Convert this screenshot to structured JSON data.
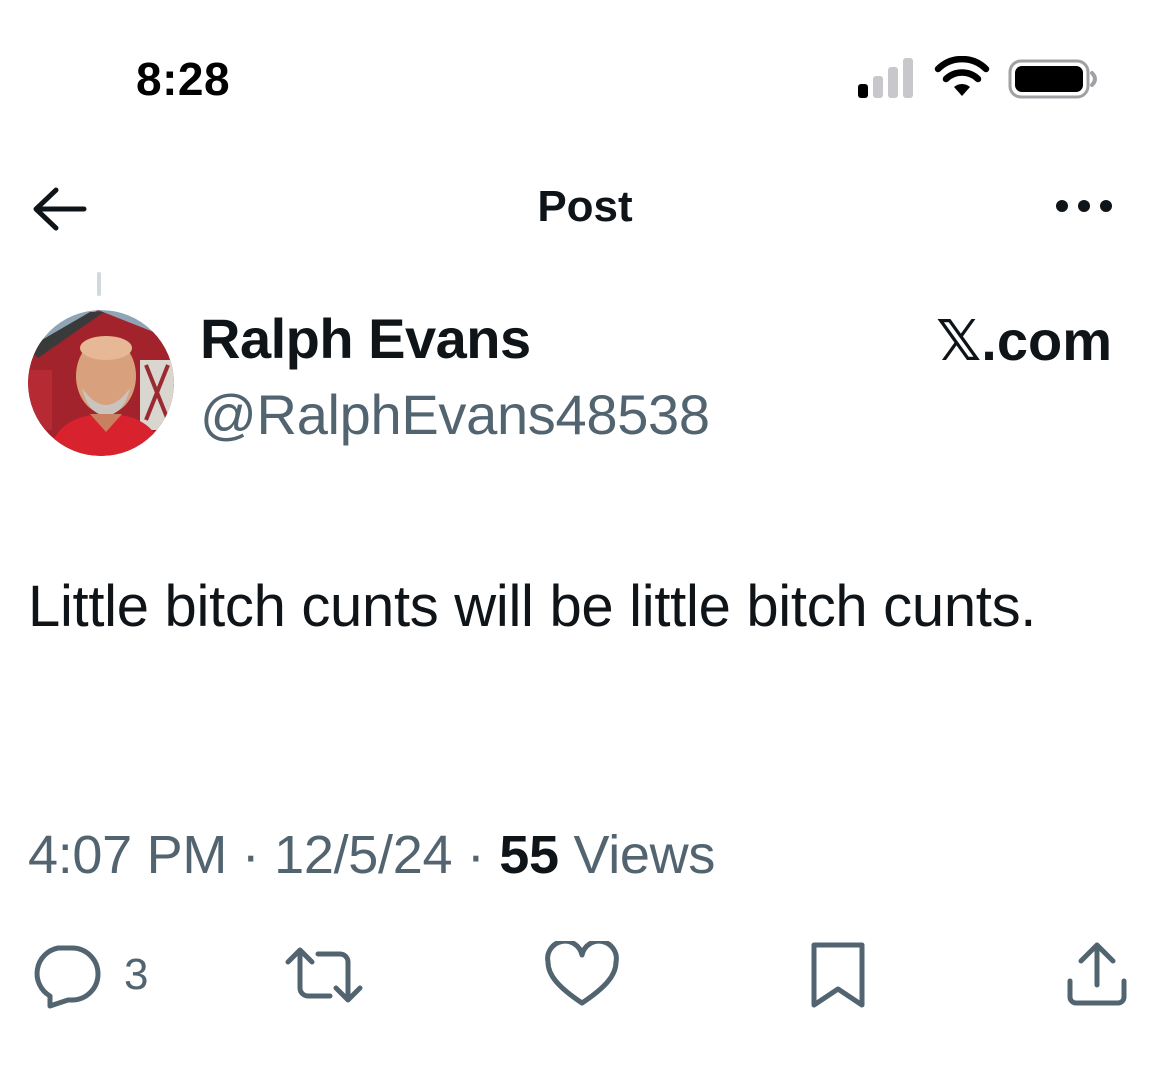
{
  "status_bar": {
    "time": "8:28",
    "icons": [
      "cellular-signal-icon",
      "wifi-icon",
      "battery-icon"
    ]
  },
  "header": {
    "title": "Post",
    "back_icon": "arrow-left-icon",
    "more_icon": "more-horizontal-icon"
  },
  "post": {
    "author": {
      "display_name": "Ralph Evans",
      "handle": "@RalphEvans48538"
    },
    "source_label": "𝕏.com",
    "text": "Little bitch cunts will be little bitch cunts.",
    "meta": {
      "time": "4:07 PM",
      "separator": "·",
      "date": "12/5/24",
      "views_count": "55",
      "views_label": "Views"
    },
    "actions": {
      "reply_count": "3",
      "icons": [
        "reply-icon",
        "repost-icon",
        "like-icon",
        "bookmark-icon",
        "share-icon"
      ]
    }
  },
  "colors": {
    "text_primary": "#0f1419",
    "text_secondary": "#536471",
    "background": "#ffffff"
  }
}
